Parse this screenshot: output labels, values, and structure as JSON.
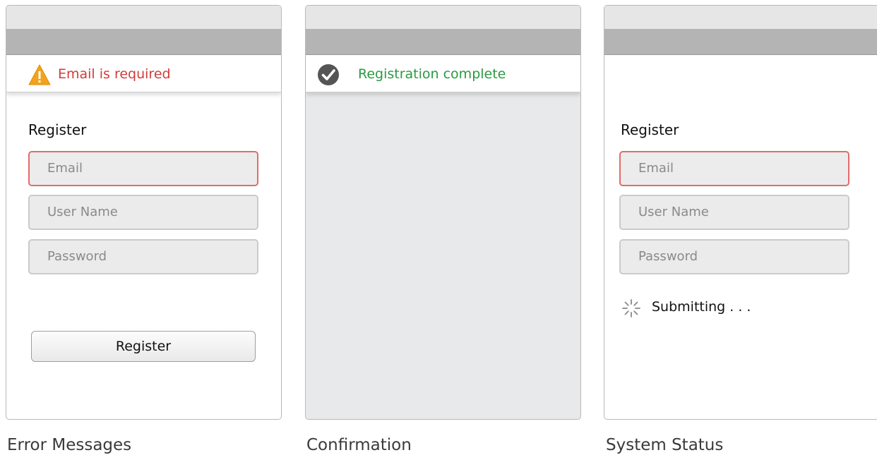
{
  "panels": [
    {
      "banner": {
        "type": "error",
        "icon": "warning-icon",
        "message": "Email is required"
      },
      "form": {
        "title": "Register",
        "fields": [
          "Email",
          "User Name",
          "Password"
        ],
        "invalid_field": "Email",
        "button_label": "Register"
      },
      "caption": "Error Messages"
    },
    {
      "banner": {
        "type": "success",
        "icon": "check-circle-icon",
        "message": "Registration complete"
      },
      "caption": "Confirmation"
    },
    {
      "form": {
        "title": "Register",
        "fields": [
          "Email",
          "User Name",
          "Password"
        ],
        "invalid_field": "Email"
      },
      "status": {
        "icon": "spinner-icon",
        "text": "Submitting . . ."
      },
      "caption": "System Status"
    }
  ],
  "colors": {
    "error": "#d23b3b",
    "success": "#2a9a41",
    "warning": "#f2a31b",
    "invalid_border": "#e36b6b"
  }
}
